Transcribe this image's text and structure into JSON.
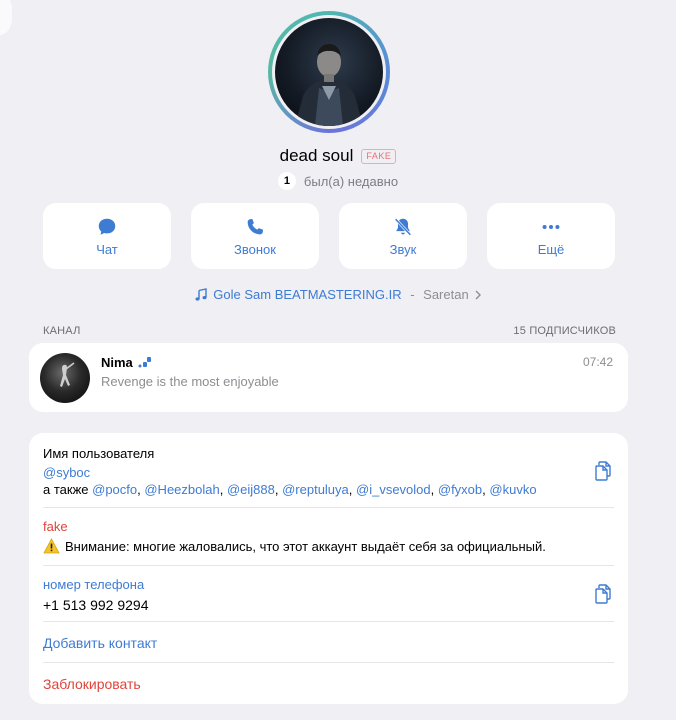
{
  "profile": {
    "name": "dead soul",
    "fake_badge": "FAKE",
    "status_count": "1",
    "status_text": "был(а) недавно"
  },
  "actions": {
    "chat": "Чат",
    "call": "Звонок",
    "sound": "Звук",
    "more": "Ещё"
  },
  "music": {
    "title": "Gole Sam BEATMASTERING.IR",
    "separator": " - ",
    "artist": "Saretan"
  },
  "channel": {
    "section_label": "КАНАЛ",
    "subscribers": "15 ПОДПИСЧИКОВ",
    "name": "Nima",
    "time": "07:42",
    "last_message": "Revenge is the most enjoyable"
  },
  "info": {
    "username_label": "Имя пользователя",
    "username": "@syboc",
    "also_label": "а также",
    "aliases": [
      "@pocfo",
      "@Heezbolah",
      "@eij888",
      "@reptuluya",
      "@i_vsevolod",
      "@fyxob",
      "@kuvko"
    ],
    "fake_label": "fake",
    "warning_text": "Внимание: многие жаловались, что этот аккаунт выдаёт себя за официальный.",
    "phone_label": "номер телефона",
    "phone": "+1 513 992 9294",
    "add_contact": "Добавить контакт",
    "block": "Заблокировать"
  },
  "colors": {
    "accent": "#3e7bd3",
    "danger": "#e0443a",
    "background": "#efeff4"
  },
  "icons": {
    "chat": "chat-bubble-icon",
    "call": "phone-icon",
    "sound": "bell-muted-icon",
    "more": "ellipsis-icon",
    "music": "music-note-icon",
    "copy": "copy-icon",
    "warning": "warning-icon",
    "chevron": "chevron-right-icon"
  }
}
